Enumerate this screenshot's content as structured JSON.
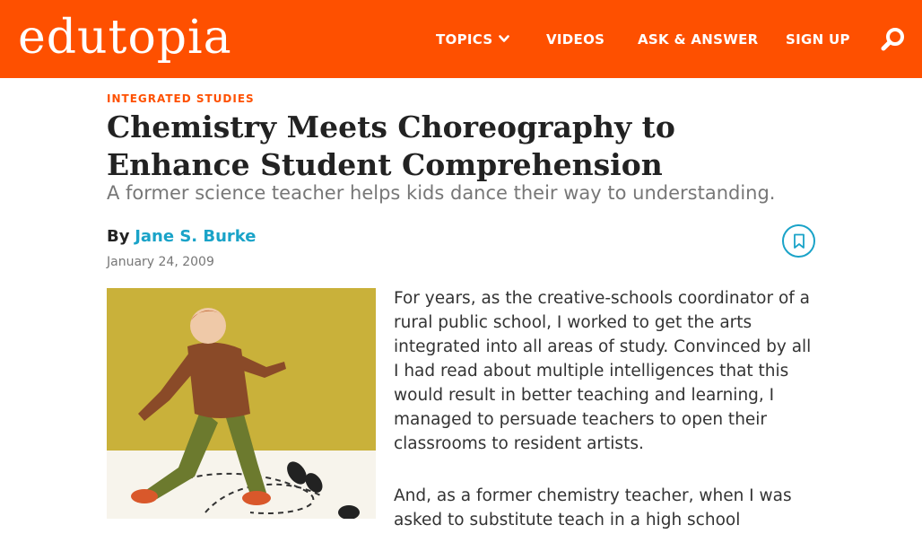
{
  "brand": {
    "logo_text": "edutopia",
    "accent_color": "#fe5000",
    "link_color": "#1aa3c8"
  },
  "nav": {
    "items": [
      {
        "label": "TOPICS",
        "has_dropdown": true
      },
      {
        "label": "VIDEOS"
      },
      {
        "label": "ASK & ANSWER"
      },
      {
        "label": "SIGN UP"
      }
    ],
    "search_icon": "search-icon"
  },
  "article": {
    "category": "INTEGRATED STUDIES",
    "title": "Chemistry Meets Choreography to Enhance Student Comprehension",
    "subtitle": "A former science teacher helps kids dance their way to understanding.",
    "by_label": "By",
    "author": "Jane S. Burke",
    "date": "January 24, 2009",
    "bookmark_icon": "bookmark-icon",
    "paragraphs": [
      "For years, as the creative-schools coordinator of a rural public school, I worked to get the arts integrated into all areas of study. Convinced by all I had read about multiple intelligences that this would result in better teaching and learning, I managed to persuade teachers to open their classrooms to resident artists.",
      "And, as a former chemistry teacher, when I was asked to substitute teach in a high school"
    ]
  }
}
